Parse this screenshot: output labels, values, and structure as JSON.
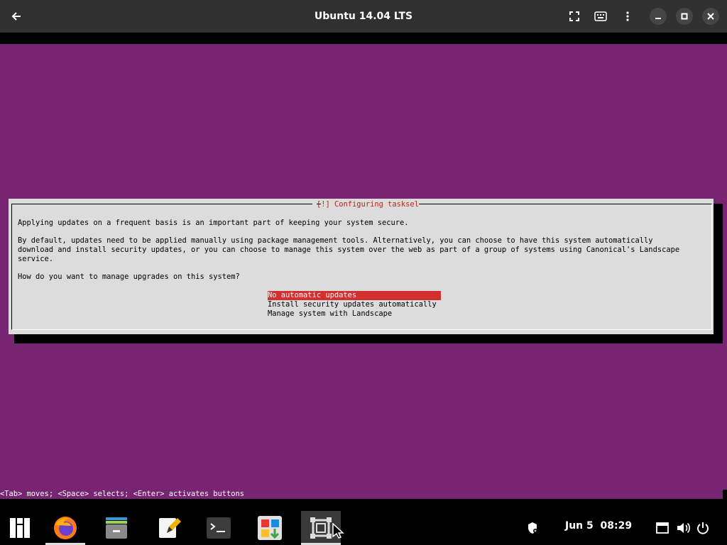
{
  "window": {
    "title": "Ubuntu 14.04 LTS",
    "icons": [
      "back-arrow-icon",
      "fullscreen-icon",
      "keyboard-icon",
      "kebab-menu-icon",
      "minimize-icon",
      "maximize-icon",
      "close-icon"
    ]
  },
  "dialog": {
    "title": "[!] Configuring tasksel",
    "paragraph1": "Applying updates on a frequent basis is an important part of keeping your system secure.",
    "paragraph2_line1": "By default, updates need to be applied manually using package management tools. Alternatively, you can choose to have this system automatically",
    "paragraph2_line2": "download and install security updates, or you can choose to manage this system over the web as part of a group of systems using Canonical's Landscape",
    "paragraph2_line3": "service.",
    "question": "How do you want to manage upgrades on this system?",
    "options": [
      {
        "label": "No automatic updates",
        "selected": true
      },
      {
        "label": "Install security updates automatically",
        "selected": false
      },
      {
        "label": "Manage system with Landscape",
        "selected": false
      }
    ]
  },
  "help_line": "<Tab> moves; <Space> selects; <Enter> activates buttons",
  "taskbar": {
    "apps": [
      "manjaro-menu-icon",
      "firefox-icon",
      "file-manager-icon",
      "text-editor-icon",
      "terminal-icon",
      "software-center-icon",
      "virtual-machine-icon"
    ],
    "clock": "Jun 5  08:29",
    "tray": [
      "security-shield-icon",
      "network-icon",
      "volume-icon",
      "power-icon"
    ]
  },
  "colors": {
    "vm_background": "#772572",
    "dialog_background": "#dcdcdc",
    "selection": "#d32f2f",
    "title_text": "#b8261c"
  }
}
